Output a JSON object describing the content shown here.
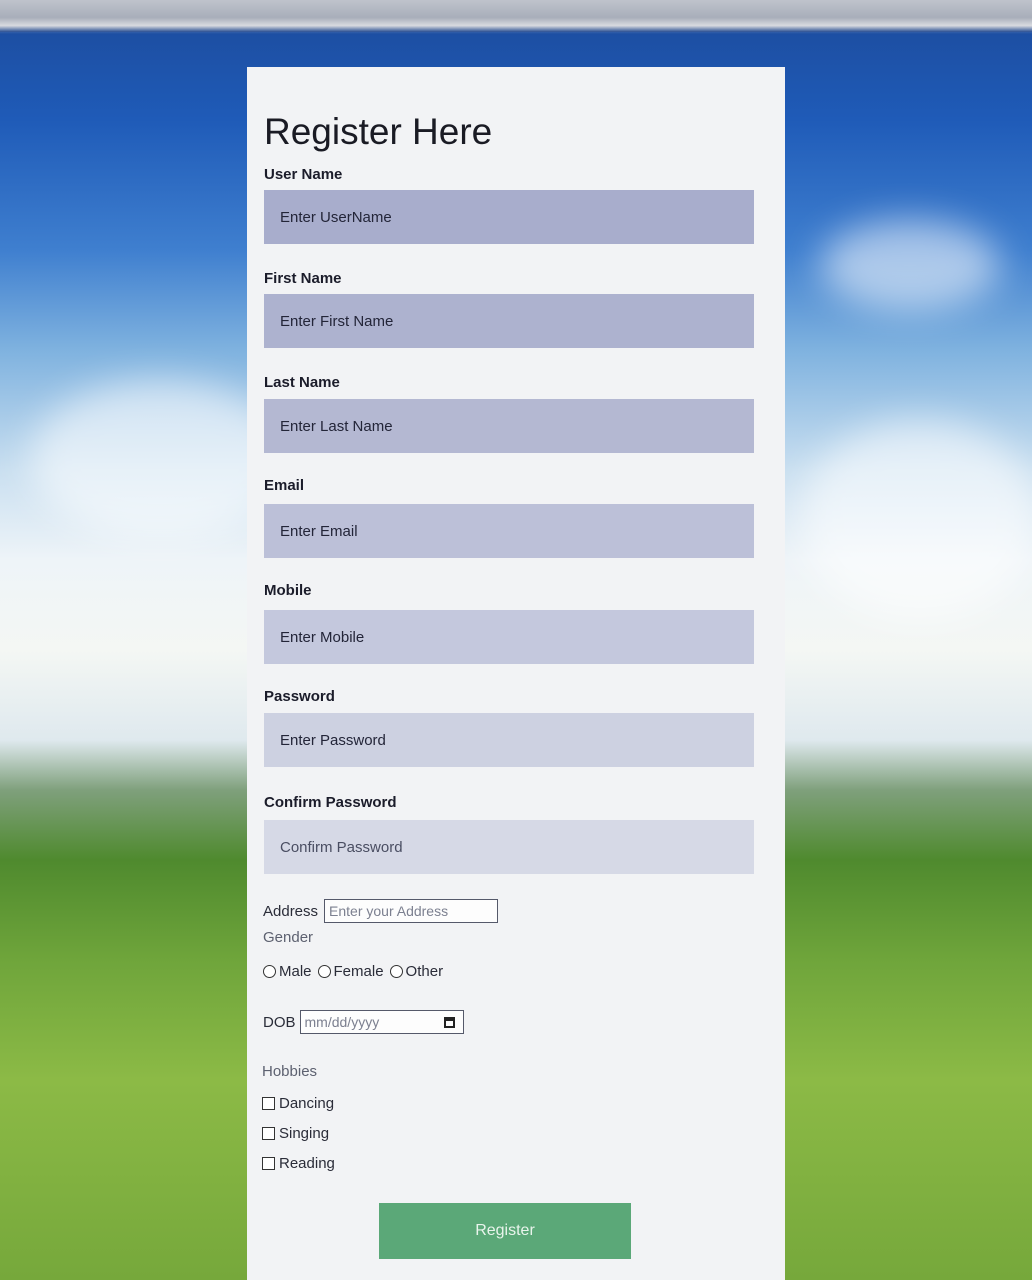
{
  "form": {
    "title": "Register Here",
    "username": {
      "label": "User Name",
      "placeholder": "Enter UserName"
    },
    "first_name": {
      "label": "First Name",
      "placeholder": "Enter First Name"
    },
    "last_name": {
      "label": "Last Name",
      "placeholder": "Enter Last Name"
    },
    "email": {
      "label": "Email",
      "placeholder": "Enter Email"
    },
    "mobile": {
      "label": "Mobile",
      "placeholder": "Enter Mobile"
    },
    "password": {
      "label": "Password",
      "placeholder": "Enter Password"
    },
    "confirm_password": {
      "label": "Confirm Password",
      "placeholder": "Confirm Password"
    },
    "address": {
      "label": "Address",
      "placeholder": "Enter your Address"
    },
    "gender": {
      "label": "Gender",
      "options": [
        "Male",
        "Female",
        "Other"
      ]
    },
    "dob": {
      "label": "DOB",
      "placeholder": "mm/dd/yyyy",
      "icon": "calendar-icon"
    },
    "hobbies": {
      "label": "Hobbies",
      "options": [
        "Dancing",
        "Singing",
        "Reading"
      ]
    },
    "submit_label": "Register"
  },
  "colors": {
    "card_bg": "#f2f3f5",
    "field_bg": "#a8adcc",
    "button_bg": "#5ba878"
  }
}
